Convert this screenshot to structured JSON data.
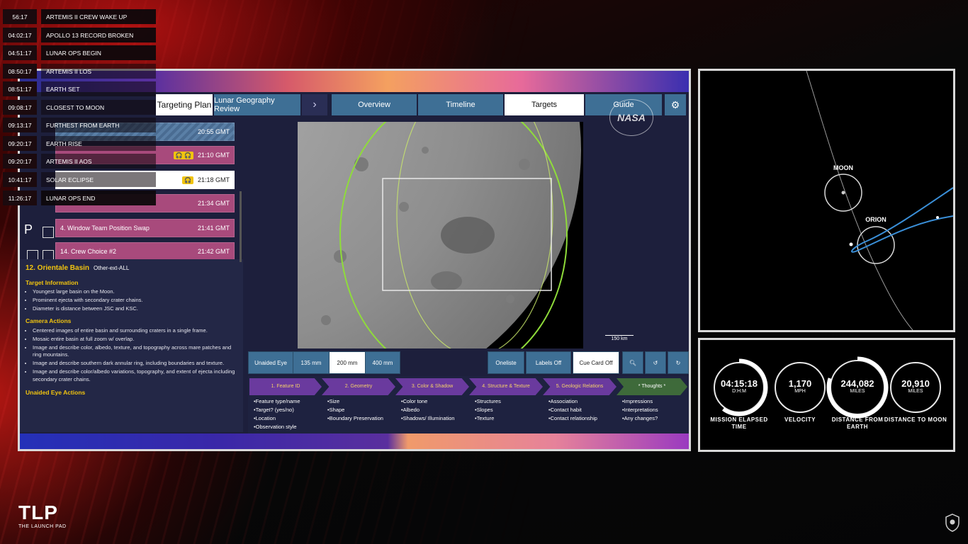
{
  "events": [
    {
      "time": "56:17",
      "label": "ARTEMIS II CREW WAKE UP"
    },
    {
      "time": "04:02:17",
      "label": "APOLLO 13 RECORD BROKEN"
    },
    {
      "time": "04:51:17",
      "label": "LUNAR OPS BEGIN"
    },
    {
      "time": "08:50:17",
      "label": "ARTEMIS II LOS"
    },
    {
      "time": "08:51:17",
      "label": "EARTH SET"
    },
    {
      "time": "09:08:17",
      "label": "CLOSEST TO MOON"
    },
    {
      "time": "09:13:17",
      "label": "FURTHEST FROM EARTH"
    },
    {
      "time": "09:20:17",
      "label": "EARTH RISE"
    },
    {
      "time": "09:20:17",
      "label": "ARTEMIS II AOS"
    },
    {
      "time": "10:41:17",
      "label": "SOLAR ECLIPSE"
    },
    {
      "time": "11:26:17",
      "label": "LUNAR OPS END"
    }
  ],
  "tabs": {
    "targeting_plan": "Targeting Plan",
    "lunar_geography": "Lunar Geography Review",
    "overview": "Overview",
    "timeline": "Timeline",
    "targets": "Targets",
    "guide": "Guide"
  },
  "nasa_logo": "NASA",
  "timeline_rows": [
    {
      "label": "",
      "time": "20:55 GMT",
      "badge": ""
    },
    {
      "label": "",
      "time": "21:10 GMT",
      "badge": "🎧 🎧"
    },
    {
      "label": "",
      "time": "21:18 GMT",
      "badge": "🎧"
    },
    {
      "label": "",
      "time": "21:34 GMT",
      "badge": ""
    },
    {
      "label": "4. Window Team Position Swap",
      "time": "21:41 GMT",
      "badge": ""
    },
    {
      "label": "14. Crew Choice #2",
      "time": "21:42 GMT",
      "badge": ""
    }
  ],
  "target": {
    "title": "12.  Orientale Basin",
    "subtitle": "Other-ext-ALL",
    "target_info_heading": "Target Information",
    "target_info": [
      "Youngest large basin on the Moon.",
      "Prominent ejecta with secondary crater chains.",
      "Diameter is distance between JSC and KSC."
    ],
    "camera_heading": "Camera Actions",
    "camera_actions": [
      "Centered images of entire basin and surrounding craters in a single frame.",
      "Mosaic entire basin at full zoom w/ overlap.",
      "Image and describe color, albedo, texture, and topography across mare patches and ring mountains.",
      "Image and describe southern dark annular ring, including boundaries and texture.",
      "Image and describe color/albedo variations, topography, and extent of ejecta including secondary crater chains."
    ],
    "unaided_heading": "Unaided Eye Actions"
  },
  "moon": {
    "scale_label": "150 km"
  },
  "lens_buttons": [
    "Unaided Eye",
    "135 mm",
    "200 mm",
    "400 mm"
  ],
  "lens_selected": "200 mm",
  "view_buttons": [
    "Oneliste",
    "Labels Off",
    "Cue Card Off"
  ],
  "feature_steps": [
    {
      "title": "1. Feature ID",
      "items": [
        "Feature type/name",
        "Target? (yes/no)",
        "Location",
        "Observation style"
      ]
    },
    {
      "title": "2. Geometry",
      "items": [
        "Size",
        "Shape",
        "Boundary Preservation"
      ]
    },
    {
      "title": "3. Color & Shadow",
      "items": [
        "Color tone",
        "Albedo",
        "Shadows/ Illumination"
      ]
    },
    {
      "title": "4. Structure & Texture",
      "items": [
        "Structures",
        "Slopes",
        "Texture"
      ]
    },
    {
      "title": "5. Geologic Relations",
      "items": [
        "Association",
        "Contact habit",
        "Contact relationship"
      ]
    },
    {
      "title": "* Thoughts *",
      "items": [
        "Impressions",
        "Interpretations",
        "Any changes?"
      ]
    }
  ],
  "orbit": {
    "moon_label": "MOON",
    "orion_label": "ORION"
  },
  "stats": [
    {
      "value": "04:15:18",
      "unit": "D:H:M",
      "label": "MISSION ELAPSED TIME",
      "progress": 0.6
    },
    {
      "value": "1,170",
      "unit": "MPH",
      "label": "VELOCITY",
      "progress": 0.0
    },
    {
      "value": "244,082",
      "unit": "MILES",
      "label": "DISTANCE FROM EARTH",
      "progress": 0.8
    },
    {
      "value": "20,910",
      "unit": "MILES",
      "label": "DISTANCE TO MOON",
      "progress": 0.0
    }
  ],
  "brand": {
    "logo": "TLP",
    "subtitle": "THE LAUNCH PAD"
  },
  "colors": {
    "tab_blue": "#3e6f95",
    "accent_yellow": "#f1c40f",
    "row_pink": "#a84a7c",
    "orbit_line": "#3a8fd8"
  }
}
